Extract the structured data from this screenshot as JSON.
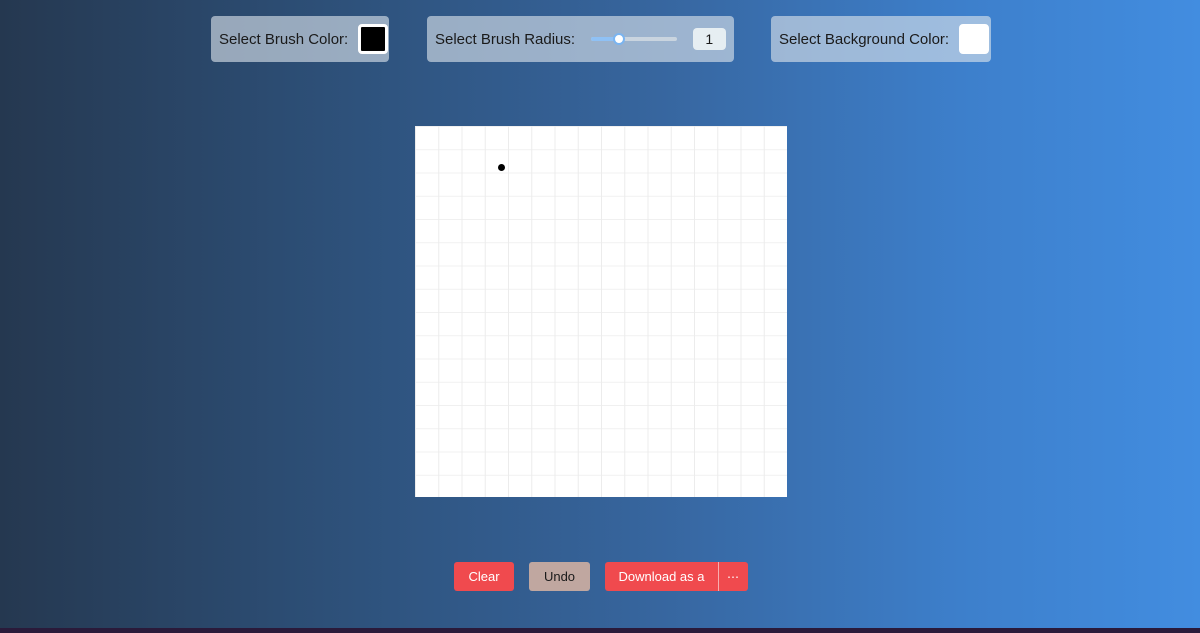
{
  "controls": {
    "brush_color": {
      "label": "Select Brush Color:",
      "color": "#000000"
    },
    "brush_radius": {
      "label": "Select Brush Radius:",
      "value": "1",
      "slider_fraction": 0.33
    },
    "background_color": {
      "label": "Select Background Color:",
      "color": "#ffffff"
    }
  },
  "canvas": {
    "background": "#ffffff",
    "stroke_color": "#000000"
  },
  "actions": {
    "clear_label": "Clear",
    "undo_label": "Undo",
    "download_label": "Download as a",
    "more_label": "⋯"
  },
  "colors": {
    "accent": "#f04a4e",
    "undo": "#c0a7a0"
  }
}
